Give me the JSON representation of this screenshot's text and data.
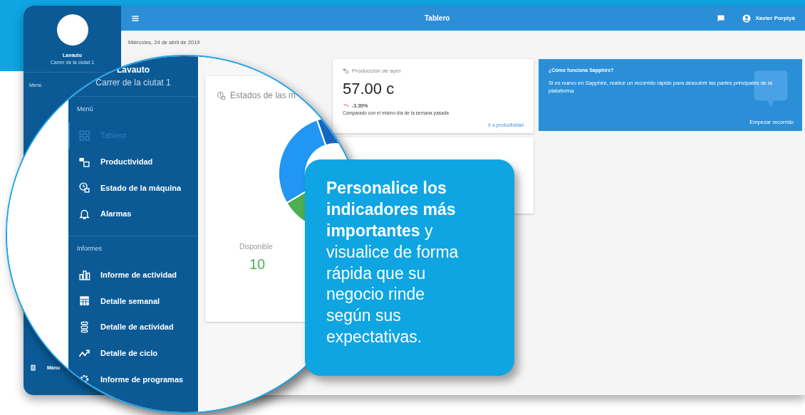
{
  "sidebar": {
    "company": "Lavauto",
    "address": "Carrer de la ciutat 1",
    "section_label": "Menú",
    "items": [
      {
        "label": "Manu"
      }
    ]
  },
  "top_bar": {
    "title": "Tablero",
    "user_name": "Xavier Porpiyà"
  },
  "content": {
    "date": "Miércoles, 24 de abril de 2019",
    "production_card": {
      "title": "Producción de ayer",
      "value": "57.00 c",
      "change": "-3.39%",
      "comparison": "Comparado con el mismo día de la semana pasada",
      "link": "Ir a productividad"
    },
    "info_card": {
      "title": "¿Cómo funciona Sapphire?",
      "text": "Si es nuevo en Sapphire, realice un recorrido rápido para descubrir las partes principales de la plataforma",
      "link": "Empezar recorrido"
    }
  },
  "magnifier": {
    "sidebar": {
      "company": "Lavauto",
      "address": "Carrer de la ciutat 1",
      "menu_label": "Menú",
      "menu_items": [
        {
          "label": "Tablero",
          "selected": true
        },
        {
          "label": "Productividad",
          "selected": false
        },
        {
          "label": "Estado de la máquina",
          "selected": false
        },
        {
          "label": "Alarmas",
          "selected": false
        }
      ],
      "reports_label": "Informes",
      "report_items": [
        {
          "label": "Informe de actividad",
          "selected": false
        },
        {
          "label": "Detalle semanal",
          "selected": false
        },
        {
          "label": "Detalle de actividad",
          "selected": false
        },
        {
          "label": "Detalle de ciclo",
          "selected": false
        },
        {
          "label": "Informe de programas",
          "selected": false
        }
      ]
    },
    "card": {
      "title": "Estados de las m",
      "legend_label": "Disponible",
      "legend_value": "10"
    }
  },
  "callout": {
    "text": "**Personalice los indicadores más importantes** y visualice de forma rápida que su negocio rinde según sus expectativas."
  }
}
